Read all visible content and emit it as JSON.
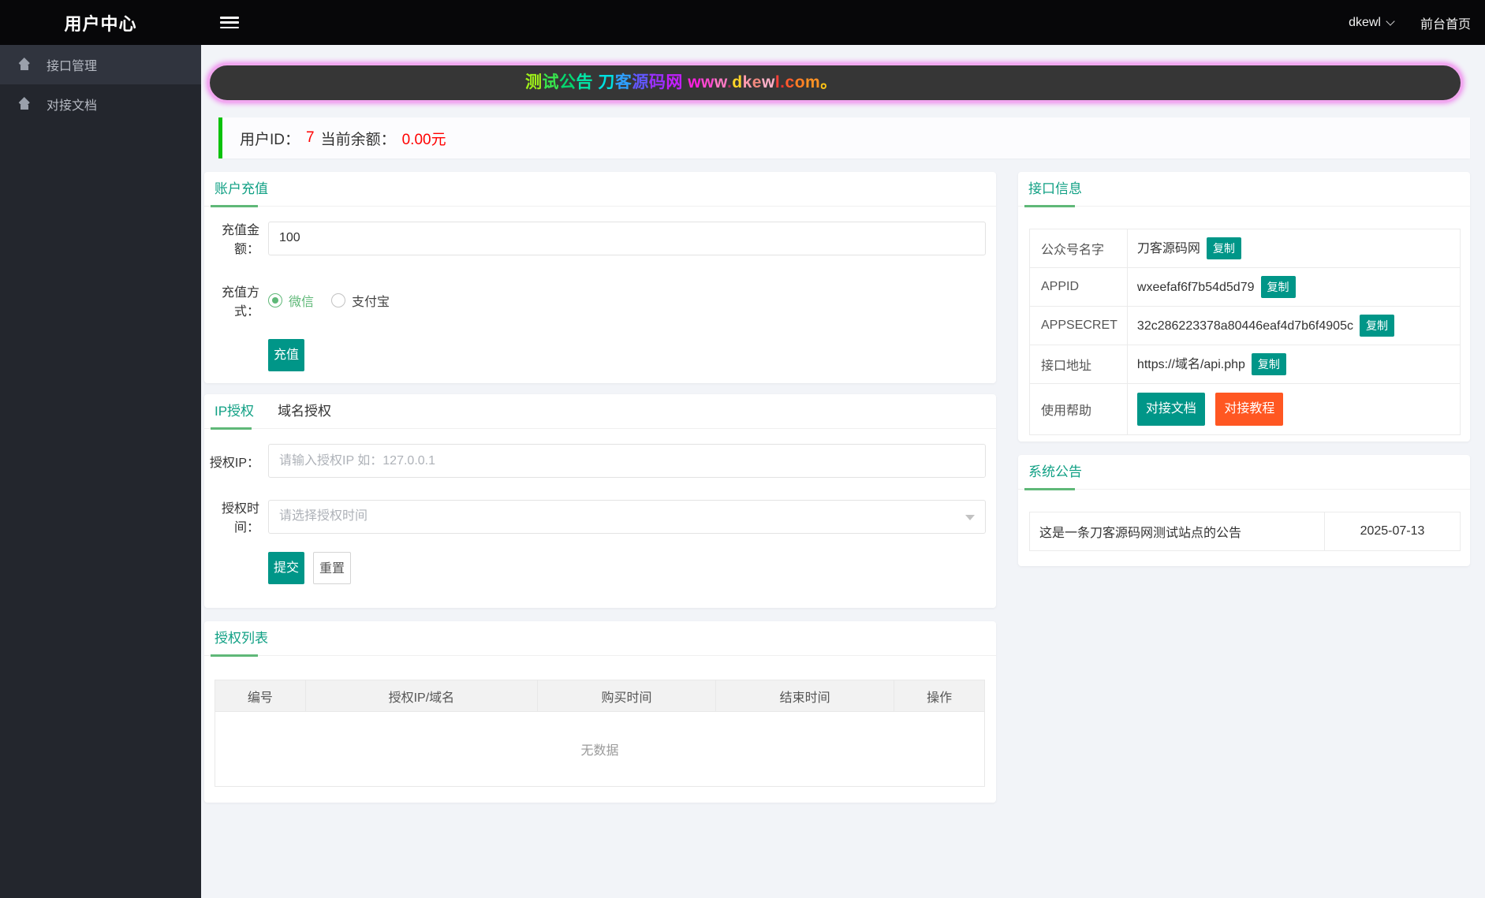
{
  "app": {
    "title": "用户中心",
    "user": "dkewl",
    "home_link": "前台首页"
  },
  "sidebar": {
    "items": [
      {
        "label": "接口管理"
      },
      {
        "label": "对接文档"
      }
    ]
  },
  "marquee": {
    "chars": [
      {
        "t": "测",
        "c": "#9ef01a"
      },
      {
        "t": "试",
        "c": "#38e54d"
      },
      {
        "t": "公",
        "c": "#06d66f"
      },
      {
        "t": "告",
        "c": "#02e8a8"
      },
      {
        "t": " ",
        "c": ""
      },
      {
        "t": "刀",
        "c": "#00e0e0"
      },
      {
        "t": "客",
        "c": "#2e9fff"
      },
      {
        "t": "源",
        "c": "#6257ff"
      },
      {
        "t": "码",
        "c": "#9b30ff"
      },
      {
        "t": "网",
        "c": "#c21fff"
      },
      {
        "t": " ",
        "c": ""
      },
      {
        "t": "w",
        "c": "#ff1fe0"
      },
      {
        "t": "w",
        "c": "#ff49d2"
      },
      {
        "t": "w",
        "c": "#ff7ac4"
      },
      {
        "t": ".",
        "c": "#b03060"
      },
      {
        "t": "d",
        "c": "#ffd428"
      },
      {
        "t": "k",
        "c": "#ff9bae"
      },
      {
        "t": "e",
        "c": "#f0887e"
      },
      {
        "t": "w",
        "c": "#ffb0c8"
      },
      {
        "t": "l",
        "c": "#ff4038"
      },
      {
        "t": ".",
        "c": "#e8332e"
      },
      {
        "t": "c",
        "c": "#ff5a2e"
      },
      {
        "t": "o",
        "c": "#ff7f24"
      },
      {
        "t": "m",
        "c": "#ff9124"
      },
      {
        "t": "。",
        "c": "#ffc414"
      }
    ]
  },
  "account_bar": {
    "id_label": "用户ID：",
    "id_value": "7",
    "balance_label": "当前余额：",
    "balance_value": "0.00元"
  },
  "recharge_card": {
    "title": "账户充值",
    "amount_label": "充值金额：",
    "amount_value": "100",
    "method_label": "充值方式：",
    "method_wechat": "微信",
    "method_alipay": "支付宝",
    "recharge_button": "充值"
  },
  "auth_card": {
    "tab_ip": "IP授权",
    "tab_domain": "域名授权",
    "ip_label": "授权IP：",
    "ip_placeholder": "请输入授权IP 如：127.0.0.1",
    "time_label": "授权时间：",
    "time_placeholder": "请选择授权时间",
    "submit_button": "提交",
    "reset_button": "重置"
  },
  "auth_list_card": {
    "title": "授权列表",
    "columns": [
      "编号",
      "授权IP/域名",
      "购买时间",
      "结束时间",
      "操作"
    ],
    "empty_text": "无数据"
  },
  "api_card": {
    "title": "接口信息",
    "rows": [
      {
        "label": "公众号名字",
        "value": "刀客源码网"
      },
      {
        "label": "APPID",
        "value": "wxeefaf6f7b54d5d79"
      },
      {
        "label": "APPSECRET",
        "value": "32c286223378a80446eaf4d7b6f4905c"
      },
      {
        "label": "接口地址",
        "value": "https://域名/api.php"
      }
    ],
    "copy_button": "复制",
    "help_label": "使用帮助",
    "doc_button": "对接文档",
    "tutorial_button": "对接教程"
  },
  "notice_card": {
    "title": "系统公告",
    "content": "这是一条刀客源码网测试站点的公告",
    "date": "2025-07-13"
  },
  "colors": {
    "accent_teal": "#009688",
    "title_teal": "#10a084",
    "tab_green": "#5FB878",
    "bar_green": "#0bc20b",
    "alert_red": "#ff0000",
    "orange": "#ff5722",
    "header_bg": "#070709",
    "sidebar_bg": "#23262d",
    "main_bg": "#f2f4f8"
  }
}
